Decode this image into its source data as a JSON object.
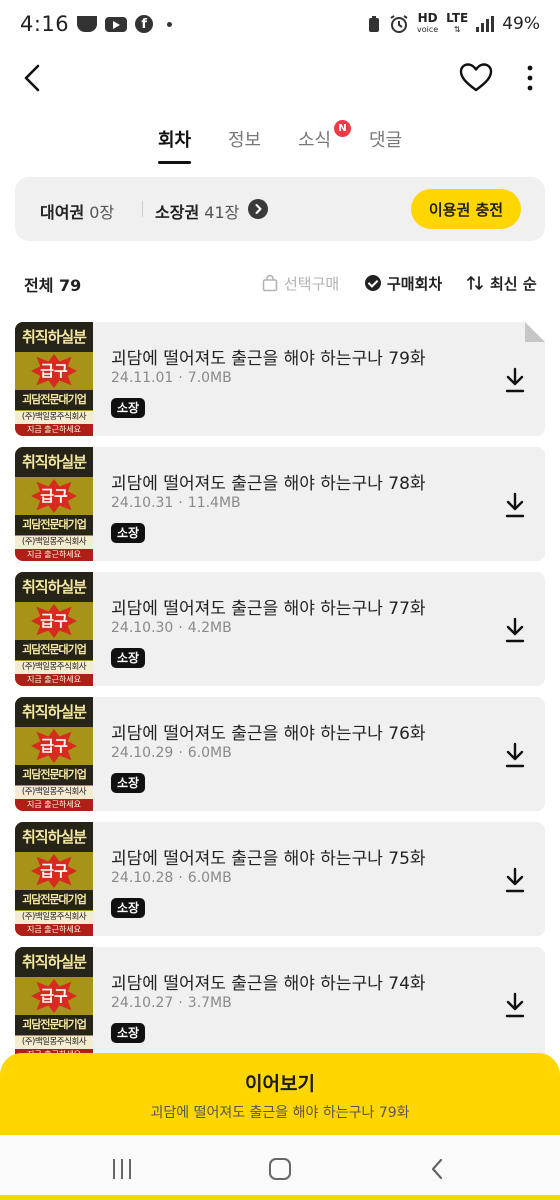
{
  "status_bar": {
    "time": "4:16",
    "hd_text": "HD",
    "hd_sub": "voice",
    "network": "LTE",
    "battery": "49%"
  },
  "header": {
    "back_icon": "chevron-left-icon",
    "favorite_icon": "heart-outline-icon",
    "more_icon": "vertical-dots-icon"
  },
  "tabs": [
    {
      "label": "회차",
      "active": true
    },
    {
      "label": "정보",
      "active": false
    },
    {
      "label": "소식",
      "active": false,
      "badge": "N"
    },
    {
      "label": "댓글",
      "active": false
    }
  ],
  "tickets": {
    "rental_label": "대여권",
    "rental_count": "0장",
    "owned_label": "소장권",
    "owned_count": "41장",
    "charge_button": "이용권 충전"
  },
  "toolbar": {
    "total": "전체 79",
    "select_buy": "선택구매",
    "purchased": "구매회차",
    "sort": "최신 순"
  },
  "thumbnail_text": {
    "top": "취직하실분",
    "star": "급구",
    "mid": "괴담전문대기업",
    "line": "(주)백일몽주식회사",
    "bottom": "지금 출근하세요"
  },
  "episodes": [
    {
      "title": "괴담에 떨어져도 출근을 해야 하는구나 79화",
      "date": "24.11.01",
      "size": "7.0MB",
      "badge": "소장"
    },
    {
      "title": "괴담에 떨어져도 출근을 해야 하는구나 78화",
      "date": "24.10.31",
      "size": "11.4MB",
      "badge": "소장"
    },
    {
      "title": "괴담에 떨어져도 출근을 해야 하는구나 77화",
      "date": "24.10.30",
      "size": "4.2MB",
      "badge": "소장"
    },
    {
      "title": "괴담에 떨어져도 출근을 해야 하는구나 76화",
      "date": "24.10.29",
      "size": "6.0MB",
      "badge": "소장"
    },
    {
      "title": "괴담에 떨어져도 출근을 해야 하는구나 75화",
      "date": "24.10.28",
      "size": "6.0MB",
      "badge": "소장"
    },
    {
      "title": "괴담에 떨어져도 출근을 해야 하는구나 74화",
      "date": "24.10.27",
      "size": "3.7MB",
      "badge": "소장"
    }
  ],
  "continue": {
    "label": "이어보기",
    "episode": "괴담에 떨어져도 출근을 해야 하는구나 79화"
  },
  "colors": {
    "accent": "#ffd600",
    "badge_red": "#f23a44",
    "card_bg": "#f0f0f0"
  }
}
